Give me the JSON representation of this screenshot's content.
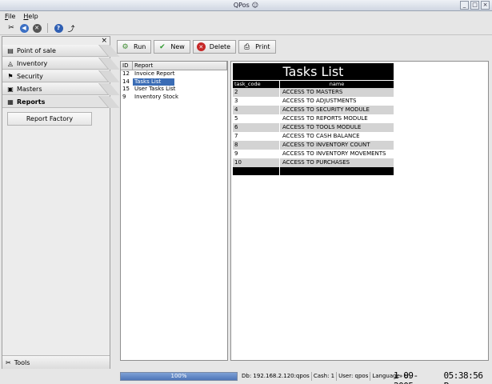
{
  "window": {
    "title": "QPos"
  },
  "menu": {
    "items": [
      "File",
      "Help"
    ]
  },
  "sidebar": {
    "items": [
      {
        "label": "Point of sale"
      },
      {
        "label": "Inventory"
      },
      {
        "label": "Security"
      },
      {
        "label": "Masters"
      },
      {
        "label": "Reports"
      }
    ],
    "report_factory": "Report Factory",
    "tools": "Tools"
  },
  "actions": {
    "run": "Run",
    "new": "New",
    "delete": "Delete",
    "print": "Print"
  },
  "report_list": {
    "headers": [
      "ID",
      "Report"
    ],
    "rows": [
      {
        "id": "12",
        "name": "Invoice Report"
      },
      {
        "id": "14",
        "name": "Tasks List"
      },
      {
        "id": "15",
        "name": "User Tasks List"
      },
      {
        "id": "9",
        "name": "Inventory Stock"
      }
    ],
    "selected_index": 1
  },
  "report": {
    "title": "Tasks List",
    "headers": [
      "task_code",
      "name"
    ],
    "rows": [
      {
        "code": "2",
        "name": "ACCESS TO MASTERS"
      },
      {
        "code": "3",
        "name": "ACCESS TO ADJUSTMENTS"
      },
      {
        "code": "4",
        "name": "ACCESS TO SECURITY MODULE"
      },
      {
        "code": "5",
        "name": "ACCESS TO REPORTS MODULE"
      },
      {
        "code": "6",
        "name": "ACCESS TO TOOLS MODULE"
      },
      {
        "code": "7",
        "name": "ACCESS TO CASH BALANCE"
      },
      {
        "code": "8",
        "name": "ACCESS TO INVENTORY COUNT"
      },
      {
        "code": "9",
        "name": "ACCESS TO INVENTORY MOVEMENTS"
      },
      {
        "code": "10",
        "name": "ACCESS TO PURCHASES"
      }
    ]
  },
  "status": {
    "progress_text": "100%",
    "progress_fraction": 1.0,
    "db": "Db: 192.168.2.120:qpos",
    "cash": "Cash: 1",
    "user": "User: qpos",
    "language": "Language: en",
    "date": "1-09-2005",
    "time": "05:38:56 P"
  },
  "colors": {
    "selection": "#3a6cb5",
    "progress": "#4f76b8"
  }
}
